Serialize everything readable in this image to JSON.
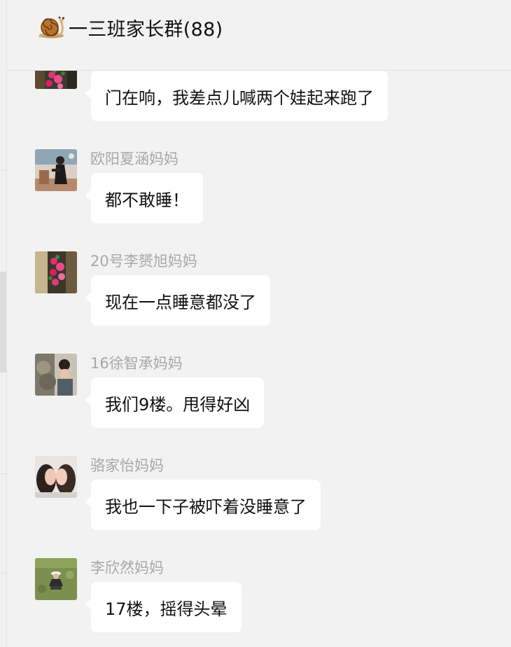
{
  "header": {
    "title": "一三班家长群(88)",
    "icon": "snail-icon"
  },
  "messages": [
    {
      "sender": "",
      "text": "门在响，我差点儿喊两个娃起来跑了",
      "avatar": "flower-wall-photo"
    },
    {
      "sender": "欧阳夏涵妈妈",
      "text": "都不敢睡！",
      "avatar": "woman-outdoor-photo"
    },
    {
      "sender": "20号李赟旭妈妈",
      "text": "现在一点睡意都没了",
      "avatar": "flower-wall-photo"
    },
    {
      "sender": "16徐智承妈妈",
      "text": "我们9楼。甩得好凶",
      "avatar": "tree-child-photo"
    },
    {
      "sender": "骆家怡妈妈",
      "text": "我也一下子被吓着没睡意了",
      "avatar": "two-people-kiss-photo"
    },
    {
      "sender": "李欣然妈妈",
      "text": "17楼，摇得头晕",
      "avatar": "child-on-grass-photo"
    }
  ],
  "colors": {
    "background": "#f2f2f2",
    "bubble": "#ffffff",
    "sender_name": "#a8a8a8",
    "text": "#111111"
  }
}
